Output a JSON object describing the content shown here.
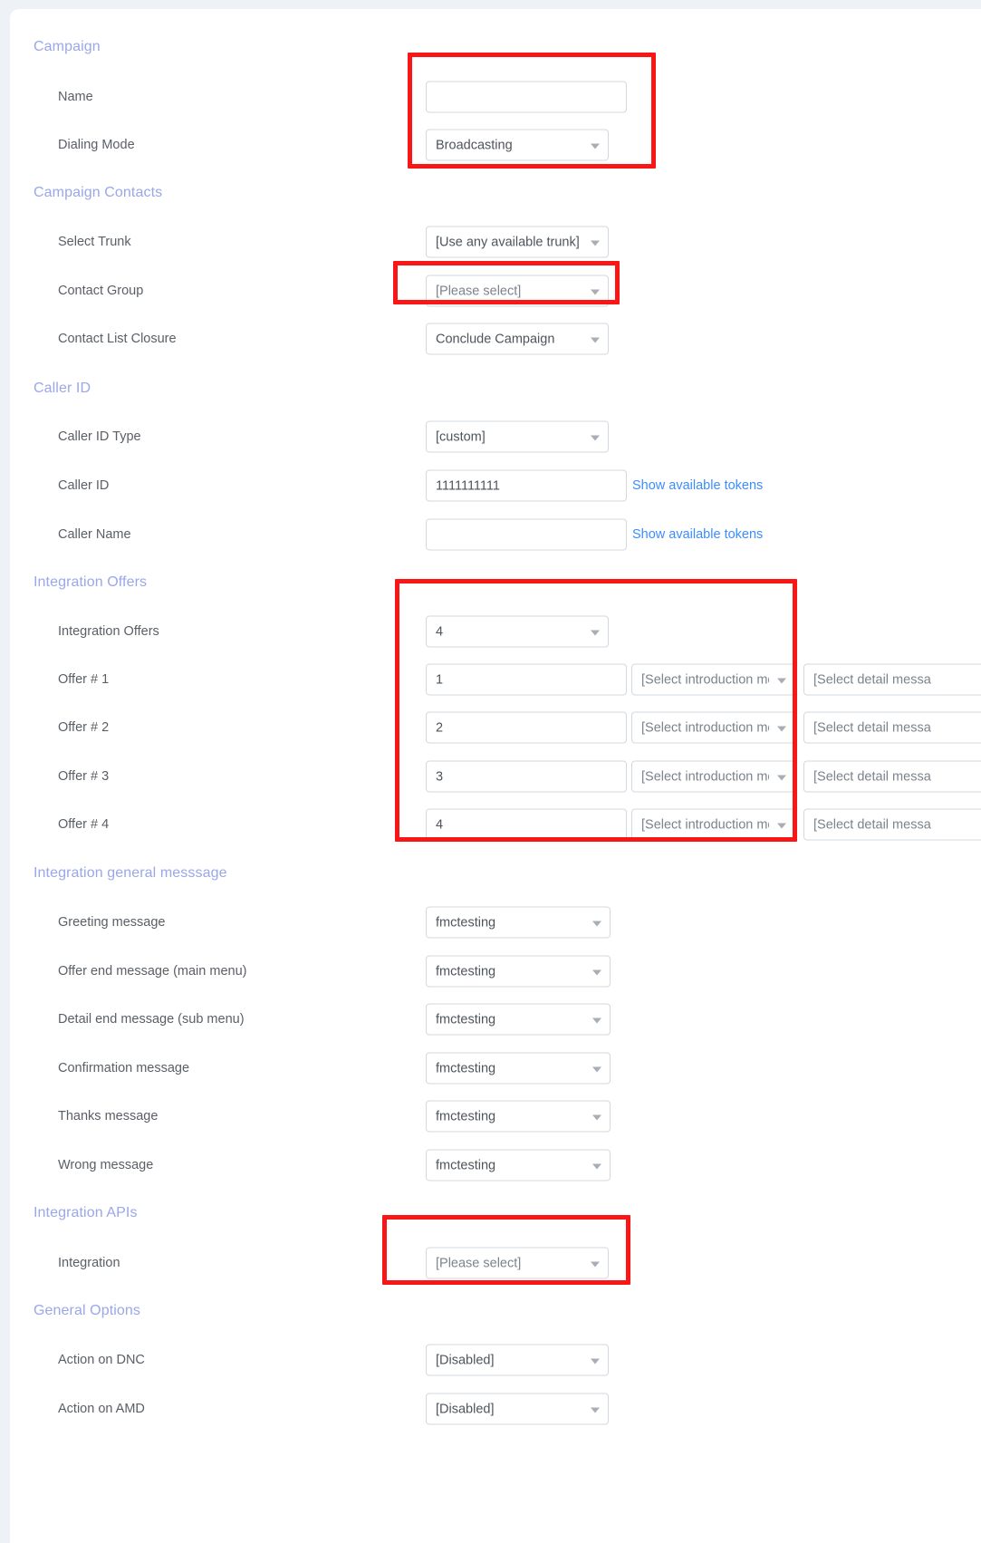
{
  "colors": {
    "page_background": "#eef1f5",
    "card_background": "#ffffff",
    "section_heading": "#9aa7e8",
    "label_text": "#5a5f66",
    "control_border": "#d3d8de",
    "link": "#3c8dfd",
    "annotation": "#f81616"
  },
  "sections": [
    {
      "key": "campaign",
      "title": "Campaign",
      "rows": [
        {
          "label": "Name",
          "type": "text",
          "value": "",
          "placeholder": ""
        },
        {
          "label": "Dialing Mode",
          "type": "select",
          "value": "Broadcasting"
        }
      ]
    },
    {
      "key": "campaign_contacts",
      "title": "Campaign Contacts",
      "rows": [
        {
          "label": "Select Trunk",
          "type": "select",
          "value": "[Use any available trunk]"
        },
        {
          "label": "Contact Group",
          "type": "select",
          "value": "[Please select]",
          "is_placeholder": true
        },
        {
          "label": "Contact List Closure",
          "type": "select",
          "value": "Conclude Campaign"
        }
      ]
    },
    {
      "key": "caller_id",
      "title": "Caller ID",
      "rows": [
        {
          "label": "Caller ID Type",
          "type": "select",
          "value": "[custom]"
        },
        {
          "label": "Caller ID",
          "type": "text",
          "value": "1111111111",
          "link": "Show available tokens"
        },
        {
          "label": "Caller Name",
          "type": "text",
          "value": "",
          "link": "Show available tokens"
        }
      ]
    },
    {
      "key": "integration_offers",
      "title": "Integration Offers",
      "count_label": "Integration Offers",
      "count_value": "4",
      "offers": [
        {
          "label": "Offer # 1",
          "value": "1",
          "intro": "[Select introduction me...",
          "detail": "[Select detail messa"
        },
        {
          "label": "Offer # 2",
          "value": "2",
          "intro": "[Select introduction me...",
          "detail": "[Select detail messa"
        },
        {
          "label": "Offer # 3",
          "value": "3",
          "intro": "[Select introduction me...",
          "detail": "[Select detail messa"
        },
        {
          "label": "Offer # 4",
          "value": "4",
          "intro": "[Select introduction me...",
          "detail": "[Select detail messa"
        }
      ]
    },
    {
      "key": "integration_general_message",
      "title": "Integration general messsage",
      "rows": [
        {
          "label": "Greeting message",
          "type": "select",
          "value": "fmctesting"
        },
        {
          "label": "Offer end message (main menu)",
          "type": "select",
          "value": "fmctesting"
        },
        {
          "label": "Detail end message (sub menu)",
          "type": "select",
          "value": "fmctesting"
        },
        {
          "label": "Confirmation message",
          "type": "select",
          "value": "fmctesting"
        },
        {
          "label": "Thanks message",
          "type": "select",
          "value": "fmctesting"
        },
        {
          "label": "Wrong message",
          "type": "select",
          "value": "fmctesting"
        }
      ]
    },
    {
      "key": "integration_apis",
      "title": "Integration APIs",
      "rows": [
        {
          "label": "Integration",
          "type": "select",
          "value": "[Please select]",
          "is_placeholder": true
        }
      ]
    },
    {
      "key": "general_options",
      "title": "General Options",
      "rows": [
        {
          "label": "Action on DNC",
          "type": "select",
          "value": "[Disabled]"
        },
        {
          "label": "Action on AMD",
          "type": "select",
          "value": "[Disabled]"
        }
      ]
    }
  ]
}
